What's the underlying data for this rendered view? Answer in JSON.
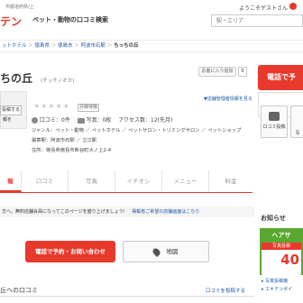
{
  "header": {
    "tagline_top": "市都道府県/上",
    "logo_partial": "テン",
    "site_name": "ペット・動物の口コミ検索",
    "greeting": "ようこそゲストさん",
    "search_placeholder": "駅・エリア"
  },
  "breadcrumb": [
    "ットホテル",
    "徳島県",
    "徳島市",
    "阿波市石駅",
    "ちっちの丘"
  ],
  "shop": {
    "title": "ちの丘",
    "reading": "(チッチノオカ)",
    "favorite_label": "お客に入り追加",
    "favorite_count": "0",
    "rating_badge": "評価待機",
    "owner_link": "▼店舗管理者情報を見る",
    "side_text_1": "報を",
    "side_text_2": "",
    "owner_btn": "投稿する",
    "reviews": "口コミ：0件",
    "photos": "写真：0枚",
    "access": "アクセス数：12(先月)",
    "genre": "ジャンル：ペット・動物 ／ ペットホテル ／ ペットサロン・トリミングサロン ／ ペットショップ",
    "station": "最寄駅：阿波市石駅 ／ 立江駅",
    "address": "住所：徳島県徳島市新谷町大ノ上2-4"
  },
  "right_panel": {
    "call_btn": "電話で予",
    "review_post": "口コミ投稿",
    "photo_post": "写"
  },
  "tabs": [
    "報",
    "口コミ",
    "写真",
    "イチオシ",
    "メニュー",
    "料金"
  ],
  "notice": {
    "text": "方へ。無料店舗会員になってこのページを盛り上げましょう!",
    "link": "掲載者ご希望の店舗画面はこちら"
  },
  "actions": {
    "call": "電話で予約・お問い合わせ",
    "map": "地図"
  },
  "section": {
    "review_title": "丘への口コミ",
    "review_post_link": "口コミを投稿する"
  },
  "sidebar": {
    "news_title": "お知らせ",
    "banner_top": "ヘアサ",
    "banner_sub": "写真投稿",
    "banner_num": "40",
    "bullet_1": "写真投稿機",
    "bullet_2": "エキテンポイ"
  },
  "colors": {
    "accent": "#e8392c",
    "link": "#1d5ba8",
    "tab_active": "#e8392c",
    "banner_green": "#5aa832"
  }
}
